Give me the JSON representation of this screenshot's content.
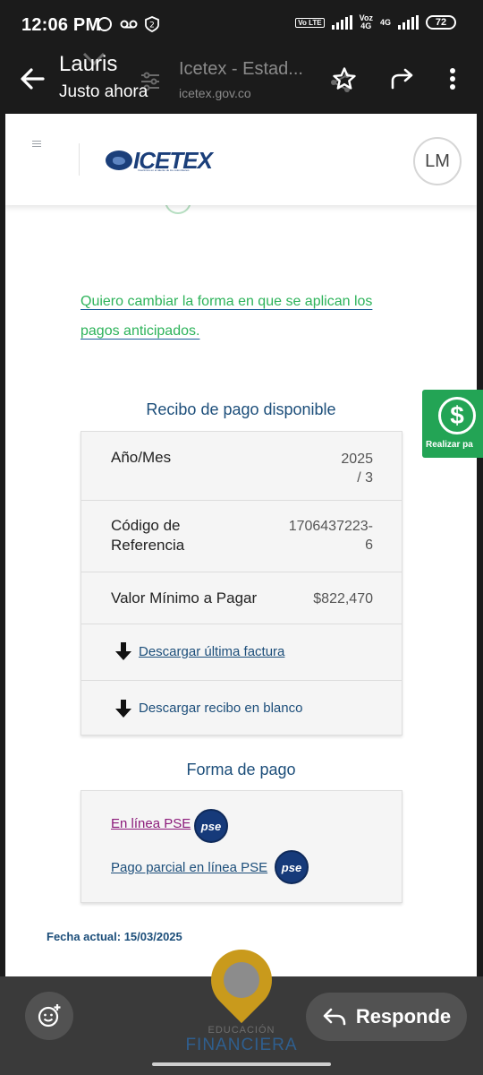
{
  "status_bar": {
    "time": "12:06 PM",
    "network_1": "Vo LTE",
    "network_2_top": "Voz",
    "network_2_bottom": "4G",
    "network_3": "4G",
    "battery": "72"
  },
  "chat_header": {
    "contact_name": "Lauris",
    "contact_status": "Justo ahora",
    "page_title": "Icetex - Estad...",
    "page_domain": "icetex.gov.co"
  },
  "site": {
    "logo_text": "ICETEX",
    "logo_tagline": "Invertimos en el talento de los colombianos",
    "avatar_initials": "LM",
    "change_link": "Quiero cambiar la forma en que se aplican los pagos anticipados.",
    "receipt_title": "Recibo de pago disponible",
    "receipt": {
      "year_month_label": "Año/Mes",
      "year_month_value_1": "2025",
      "year_month_value_2": "/ 3",
      "reference_label_1": "Código de",
      "reference_label_2": "Referencia",
      "reference_value_1": "1706437223-",
      "reference_value_2": "6",
      "min_value_label": "Valor Mínimo a Pagar",
      "min_value": "$822,470",
      "download_last": "Descargar última factura",
      "download_blank": "Descargar recibo en blanco"
    },
    "payment_title": "Forma de pago",
    "payment": {
      "online_pse": "En línea PSE",
      "partial_pse": "Pago parcial en línea PSE",
      "pse_badge": "pse"
    },
    "current_date": "Fecha actual: 15/03/2025",
    "side_pay_label": "Realizar pa"
  },
  "bottom_bar": {
    "reply_label": "Responde",
    "edu_small": "EDUCACIÓN",
    "edu_big": "FINANCIERA"
  },
  "colors": {
    "accent_green": "#2db35a",
    "brand_blue": "#1c4e7a",
    "link_purple": "#8b1a7a"
  }
}
